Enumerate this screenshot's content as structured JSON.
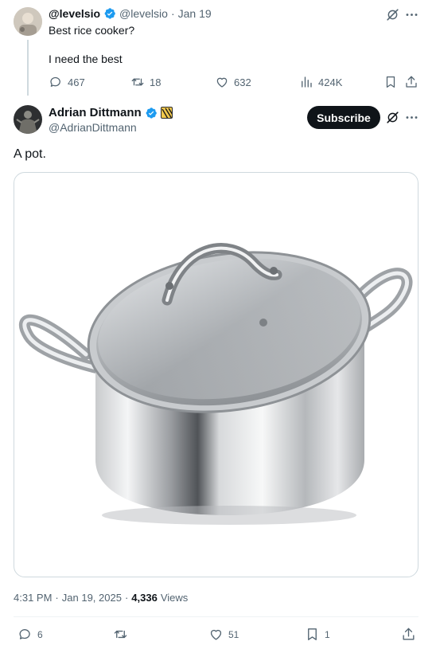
{
  "colors": {
    "accent": "#1d9bf0",
    "text": "#0f1419",
    "muted": "#536471",
    "border": "#eff3f4"
  },
  "parent_tweet": {
    "display_name": "@levelsio",
    "handle": "@levelsio",
    "sep": "·",
    "date": "Jan 19",
    "text_line1": "Best rice cooker?",
    "text_line2": "I need the best",
    "replies": "467",
    "retweets": "18",
    "likes": "632",
    "views": "424K"
  },
  "main_tweet": {
    "display_name": "Adrian Dittmann",
    "handle": "@AdrianDittmann",
    "subscribe_label": "Subscribe",
    "text": "A pot.",
    "time": "4:31 PM",
    "date": "Jan 19, 2025",
    "sep1": "·",
    "sep2": "·",
    "views_count": "4,336",
    "views_label": "Views",
    "replies": "6",
    "retweets": "",
    "likes": "51",
    "bookmarks": "1"
  },
  "icons": {
    "verified": "verified-badge-icon",
    "grok": "grok-icon",
    "more": "more-dots-icon",
    "reply": "reply-icon",
    "retweet": "retweet-icon",
    "like": "heart-icon",
    "views": "views-bar-icon",
    "bookmark": "bookmark-icon",
    "share": "share-icon"
  }
}
